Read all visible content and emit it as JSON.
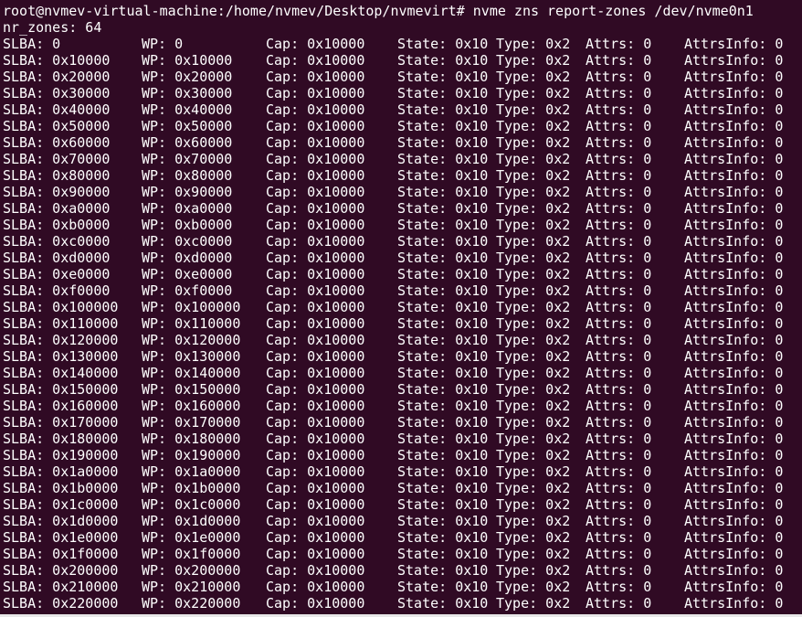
{
  "terminal": {
    "command_line": "root@nvmev-virtual-machine:/home/nvmev/Desktop/nvmevirt# nvme zns report-zones /dev/nvme0n1",
    "summary": "nr_zones: 64",
    "zones": [
      {
        "slba": "SLBA: 0",
        "wp": "WP: 0",
        "cap": "Cap: 0x10000",
        "state": "State: 0x10",
        "type": "Type: 0x2",
        "attrs": "Attrs: 0",
        "attrs_info": "AttrsInfo: 0"
      },
      {
        "slba": "SLBA: 0x10000",
        "wp": "WP: 0x10000",
        "cap": "Cap: 0x10000",
        "state": "State: 0x10",
        "type": "Type: 0x2",
        "attrs": "Attrs: 0",
        "attrs_info": "AttrsInfo: 0"
      },
      {
        "slba": "SLBA: 0x20000",
        "wp": "WP: 0x20000",
        "cap": "Cap: 0x10000",
        "state": "State: 0x10",
        "type": "Type: 0x2",
        "attrs": "Attrs: 0",
        "attrs_info": "AttrsInfo: 0"
      },
      {
        "slba": "SLBA: 0x30000",
        "wp": "WP: 0x30000",
        "cap": "Cap: 0x10000",
        "state": "State: 0x10",
        "type": "Type: 0x2",
        "attrs": "Attrs: 0",
        "attrs_info": "AttrsInfo: 0"
      },
      {
        "slba": "SLBA: 0x40000",
        "wp": "WP: 0x40000",
        "cap": "Cap: 0x10000",
        "state": "State: 0x10",
        "type": "Type: 0x2",
        "attrs": "Attrs: 0",
        "attrs_info": "AttrsInfo: 0"
      },
      {
        "slba": "SLBA: 0x50000",
        "wp": "WP: 0x50000",
        "cap": "Cap: 0x10000",
        "state": "State: 0x10",
        "type": "Type: 0x2",
        "attrs": "Attrs: 0",
        "attrs_info": "AttrsInfo: 0"
      },
      {
        "slba": "SLBA: 0x60000",
        "wp": "WP: 0x60000",
        "cap": "Cap: 0x10000",
        "state": "State: 0x10",
        "type": "Type: 0x2",
        "attrs": "Attrs: 0",
        "attrs_info": "AttrsInfo: 0"
      },
      {
        "slba": "SLBA: 0x70000",
        "wp": "WP: 0x70000",
        "cap": "Cap: 0x10000",
        "state": "State: 0x10",
        "type": "Type: 0x2",
        "attrs": "Attrs: 0",
        "attrs_info": "AttrsInfo: 0"
      },
      {
        "slba": "SLBA: 0x80000",
        "wp": "WP: 0x80000",
        "cap": "Cap: 0x10000",
        "state": "State: 0x10",
        "type": "Type: 0x2",
        "attrs": "Attrs: 0",
        "attrs_info": "AttrsInfo: 0"
      },
      {
        "slba": "SLBA: 0x90000",
        "wp": "WP: 0x90000",
        "cap": "Cap: 0x10000",
        "state": "State: 0x10",
        "type": "Type: 0x2",
        "attrs": "Attrs: 0",
        "attrs_info": "AttrsInfo: 0"
      },
      {
        "slba": "SLBA: 0xa0000",
        "wp": "WP: 0xa0000",
        "cap": "Cap: 0x10000",
        "state": "State: 0x10",
        "type": "Type: 0x2",
        "attrs": "Attrs: 0",
        "attrs_info": "AttrsInfo: 0"
      },
      {
        "slba": "SLBA: 0xb0000",
        "wp": "WP: 0xb0000",
        "cap": "Cap: 0x10000",
        "state": "State: 0x10",
        "type": "Type: 0x2",
        "attrs": "Attrs: 0",
        "attrs_info": "AttrsInfo: 0"
      },
      {
        "slba": "SLBA: 0xc0000",
        "wp": "WP: 0xc0000",
        "cap": "Cap: 0x10000",
        "state": "State: 0x10",
        "type": "Type: 0x2",
        "attrs": "Attrs: 0",
        "attrs_info": "AttrsInfo: 0"
      },
      {
        "slba": "SLBA: 0xd0000",
        "wp": "WP: 0xd0000",
        "cap": "Cap: 0x10000",
        "state": "State: 0x10",
        "type": "Type: 0x2",
        "attrs": "Attrs: 0",
        "attrs_info": "AttrsInfo: 0"
      },
      {
        "slba": "SLBA: 0xe0000",
        "wp": "WP: 0xe0000",
        "cap": "Cap: 0x10000",
        "state": "State: 0x10",
        "type": "Type: 0x2",
        "attrs": "Attrs: 0",
        "attrs_info": "AttrsInfo: 0"
      },
      {
        "slba": "SLBA: 0xf0000",
        "wp": "WP: 0xf0000",
        "cap": "Cap: 0x10000",
        "state": "State: 0x10",
        "type": "Type: 0x2",
        "attrs": "Attrs: 0",
        "attrs_info": "AttrsInfo: 0"
      },
      {
        "slba": "SLBA: 0x100000",
        "wp": "WP: 0x100000",
        "cap": "Cap: 0x10000",
        "state": "State: 0x10",
        "type": "Type: 0x2",
        "attrs": "Attrs: 0",
        "attrs_info": "AttrsInfo: 0"
      },
      {
        "slba": "SLBA: 0x110000",
        "wp": "WP: 0x110000",
        "cap": "Cap: 0x10000",
        "state": "State: 0x10",
        "type": "Type: 0x2",
        "attrs": "Attrs: 0",
        "attrs_info": "AttrsInfo: 0"
      },
      {
        "slba": "SLBA: 0x120000",
        "wp": "WP: 0x120000",
        "cap": "Cap: 0x10000",
        "state": "State: 0x10",
        "type": "Type: 0x2",
        "attrs": "Attrs: 0",
        "attrs_info": "AttrsInfo: 0"
      },
      {
        "slba": "SLBA: 0x130000",
        "wp": "WP: 0x130000",
        "cap": "Cap: 0x10000",
        "state": "State: 0x10",
        "type": "Type: 0x2",
        "attrs": "Attrs: 0",
        "attrs_info": "AttrsInfo: 0"
      },
      {
        "slba": "SLBA: 0x140000",
        "wp": "WP: 0x140000",
        "cap": "Cap: 0x10000",
        "state": "State: 0x10",
        "type": "Type: 0x2",
        "attrs": "Attrs: 0",
        "attrs_info": "AttrsInfo: 0"
      },
      {
        "slba": "SLBA: 0x150000",
        "wp": "WP: 0x150000",
        "cap": "Cap: 0x10000",
        "state": "State: 0x10",
        "type": "Type: 0x2",
        "attrs": "Attrs: 0",
        "attrs_info": "AttrsInfo: 0"
      },
      {
        "slba": "SLBA: 0x160000",
        "wp": "WP: 0x160000",
        "cap": "Cap: 0x10000",
        "state": "State: 0x10",
        "type": "Type: 0x2",
        "attrs": "Attrs: 0",
        "attrs_info": "AttrsInfo: 0"
      },
      {
        "slba": "SLBA: 0x170000",
        "wp": "WP: 0x170000",
        "cap": "Cap: 0x10000",
        "state": "State: 0x10",
        "type": "Type: 0x2",
        "attrs": "Attrs: 0",
        "attrs_info": "AttrsInfo: 0"
      },
      {
        "slba": "SLBA: 0x180000",
        "wp": "WP: 0x180000",
        "cap": "Cap: 0x10000",
        "state": "State: 0x10",
        "type": "Type: 0x2",
        "attrs": "Attrs: 0",
        "attrs_info": "AttrsInfo: 0"
      },
      {
        "slba": "SLBA: 0x190000",
        "wp": "WP: 0x190000",
        "cap": "Cap: 0x10000",
        "state": "State: 0x10",
        "type": "Type: 0x2",
        "attrs": "Attrs: 0",
        "attrs_info": "AttrsInfo: 0"
      },
      {
        "slba": "SLBA: 0x1a0000",
        "wp": "WP: 0x1a0000",
        "cap": "Cap: 0x10000",
        "state": "State: 0x10",
        "type": "Type: 0x2",
        "attrs": "Attrs: 0",
        "attrs_info": "AttrsInfo: 0"
      },
      {
        "slba": "SLBA: 0x1b0000",
        "wp": "WP: 0x1b0000",
        "cap": "Cap: 0x10000",
        "state": "State: 0x10",
        "type": "Type: 0x2",
        "attrs": "Attrs: 0",
        "attrs_info": "AttrsInfo: 0"
      },
      {
        "slba": "SLBA: 0x1c0000",
        "wp": "WP: 0x1c0000",
        "cap": "Cap: 0x10000",
        "state": "State: 0x10",
        "type": "Type: 0x2",
        "attrs": "Attrs: 0",
        "attrs_info": "AttrsInfo: 0"
      },
      {
        "slba": "SLBA: 0x1d0000",
        "wp": "WP: 0x1d0000",
        "cap": "Cap: 0x10000",
        "state": "State: 0x10",
        "type": "Type: 0x2",
        "attrs": "Attrs: 0",
        "attrs_info": "AttrsInfo: 0"
      },
      {
        "slba": "SLBA: 0x1e0000",
        "wp": "WP: 0x1e0000",
        "cap": "Cap: 0x10000",
        "state": "State: 0x10",
        "type": "Type: 0x2",
        "attrs": "Attrs: 0",
        "attrs_info": "AttrsInfo: 0"
      },
      {
        "slba": "SLBA: 0x1f0000",
        "wp": "WP: 0x1f0000",
        "cap": "Cap: 0x10000",
        "state": "State: 0x10",
        "type": "Type: 0x2",
        "attrs": "Attrs: 0",
        "attrs_info": "AttrsInfo: 0"
      },
      {
        "slba": "SLBA: 0x200000",
        "wp": "WP: 0x200000",
        "cap": "Cap: 0x10000",
        "state": "State: 0x10",
        "type": "Type: 0x2",
        "attrs": "Attrs: 0",
        "attrs_info": "AttrsInfo: 0"
      },
      {
        "slba": "SLBA: 0x210000",
        "wp": "WP: 0x210000",
        "cap": "Cap: 0x10000",
        "state": "State: 0x10",
        "type": "Type: 0x2",
        "attrs": "Attrs: 0",
        "attrs_info": "AttrsInfo: 0"
      },
      {
        "slba": "SLBA: 0x220000",
        "wp": "WP: 0x220000",
        "cap": "Cap: 0x10000",
        "state": "State: 0x10",
        "type": "Type: 0x2",
        "attrs": "Attrs: 0",
        "attrs_info": "AttrsInfo: 0"
      }
    ]
  },
  "colors": {
    "background": "#300a24",
    "foreground": "#ffffff"
  }
}
